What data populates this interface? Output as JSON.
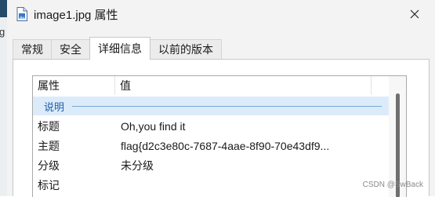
{
  "window": {
    "title": "image1.jpg 属性",
    "close_icon": "close-icon",
    "file_icon": "jpg-file-icon",
    "behind_window_char": "g"
  },
  "tabs": [
    {
      "label": "常规",
      "active": false
    },
    {
      "label": "安全",
      "active": false
    },
    {
      "label": "详细信息",
      "active": true
    },
    {
      "label": "以前的版本",
      "active": false
    }
  ],
  "details": {
    "columns": {
      "property": "属性",
      "value": "值"
    },
    "group": "说明",
    "rows": [
      {
        "key": "标题",
        "value": "Oh,you find it"
      },
      {
        "key": "主题",
        "value": "flag{d2c3e80c-7687-4aae-8f90-70e43df9..."
      },
      {
        "key": "分级",
        "value": "未分级"
      },
      {
        "key": "标记",
        "value": ""
      }
    ]
  },
  "watermark": "CSDN @SwBack",
  "colors": {
    "dialog_bg": "#f3f3f3",
    "group_bg": "#dcebfa",
    "group_text": "#1f5fa8",
    "border": "#a9a9a9"
  }
}
